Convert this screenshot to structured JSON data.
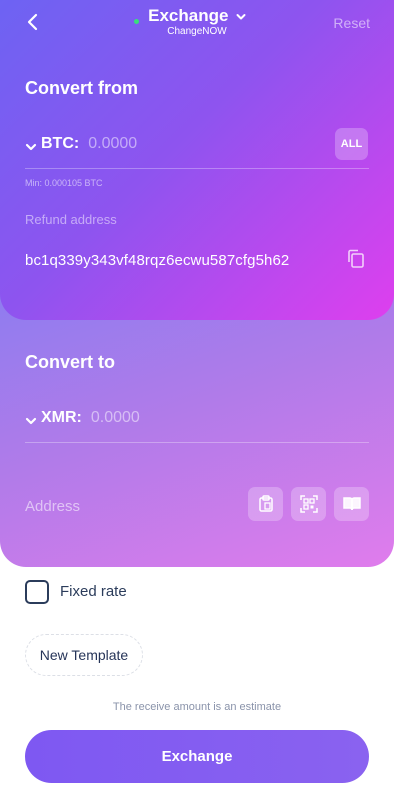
{
  "header": {
    "title": "Exchange",
    "subtitle": "ChangeNOW",
    "reset_label": "Reset",
    "status_color": "#37e07a"
  },
  "from": {
    "section_title": "Convert from",
    "coin": "BTC:",
    "amount_placeholder": "0.0000",
    "all_label": "ALL",
    "min_text": "Min: 0.000105 BTC",
    "refund_label": "Refund address",
    "refund_value": "bc1q339y343vf48rqz6ecwu587cfg5h62"
  },
  "to": {
    "section_title": "Convert to",
    "coin": "XMR:",
    "amount_placeholder": "0.0000",
    "address_placeholder": "Address"
  },
  "options": {
    "fixed_rate_label": "Fixed rate",
    "fixed_rate_checked": false,
    "new_template_label": "New Template"
  },
  "footer": {
    "estimate_text": "The receive amount is an estimate",
    "exchange_label": "Exchange"
  },
  "icons": {
    "back": "chevron-left-icon",
    "title_dropdown": "chevron-down-icon",
    "copy": "copy-icon",
    "paste": "clipboard-icon",
    "qr": "qr-scan-icon",
    "address_book": "book-icon"
  },
  "colors": {
    "accent": "#7e58f2",
    "text_dark": "#2b3c5b"
  }
}
